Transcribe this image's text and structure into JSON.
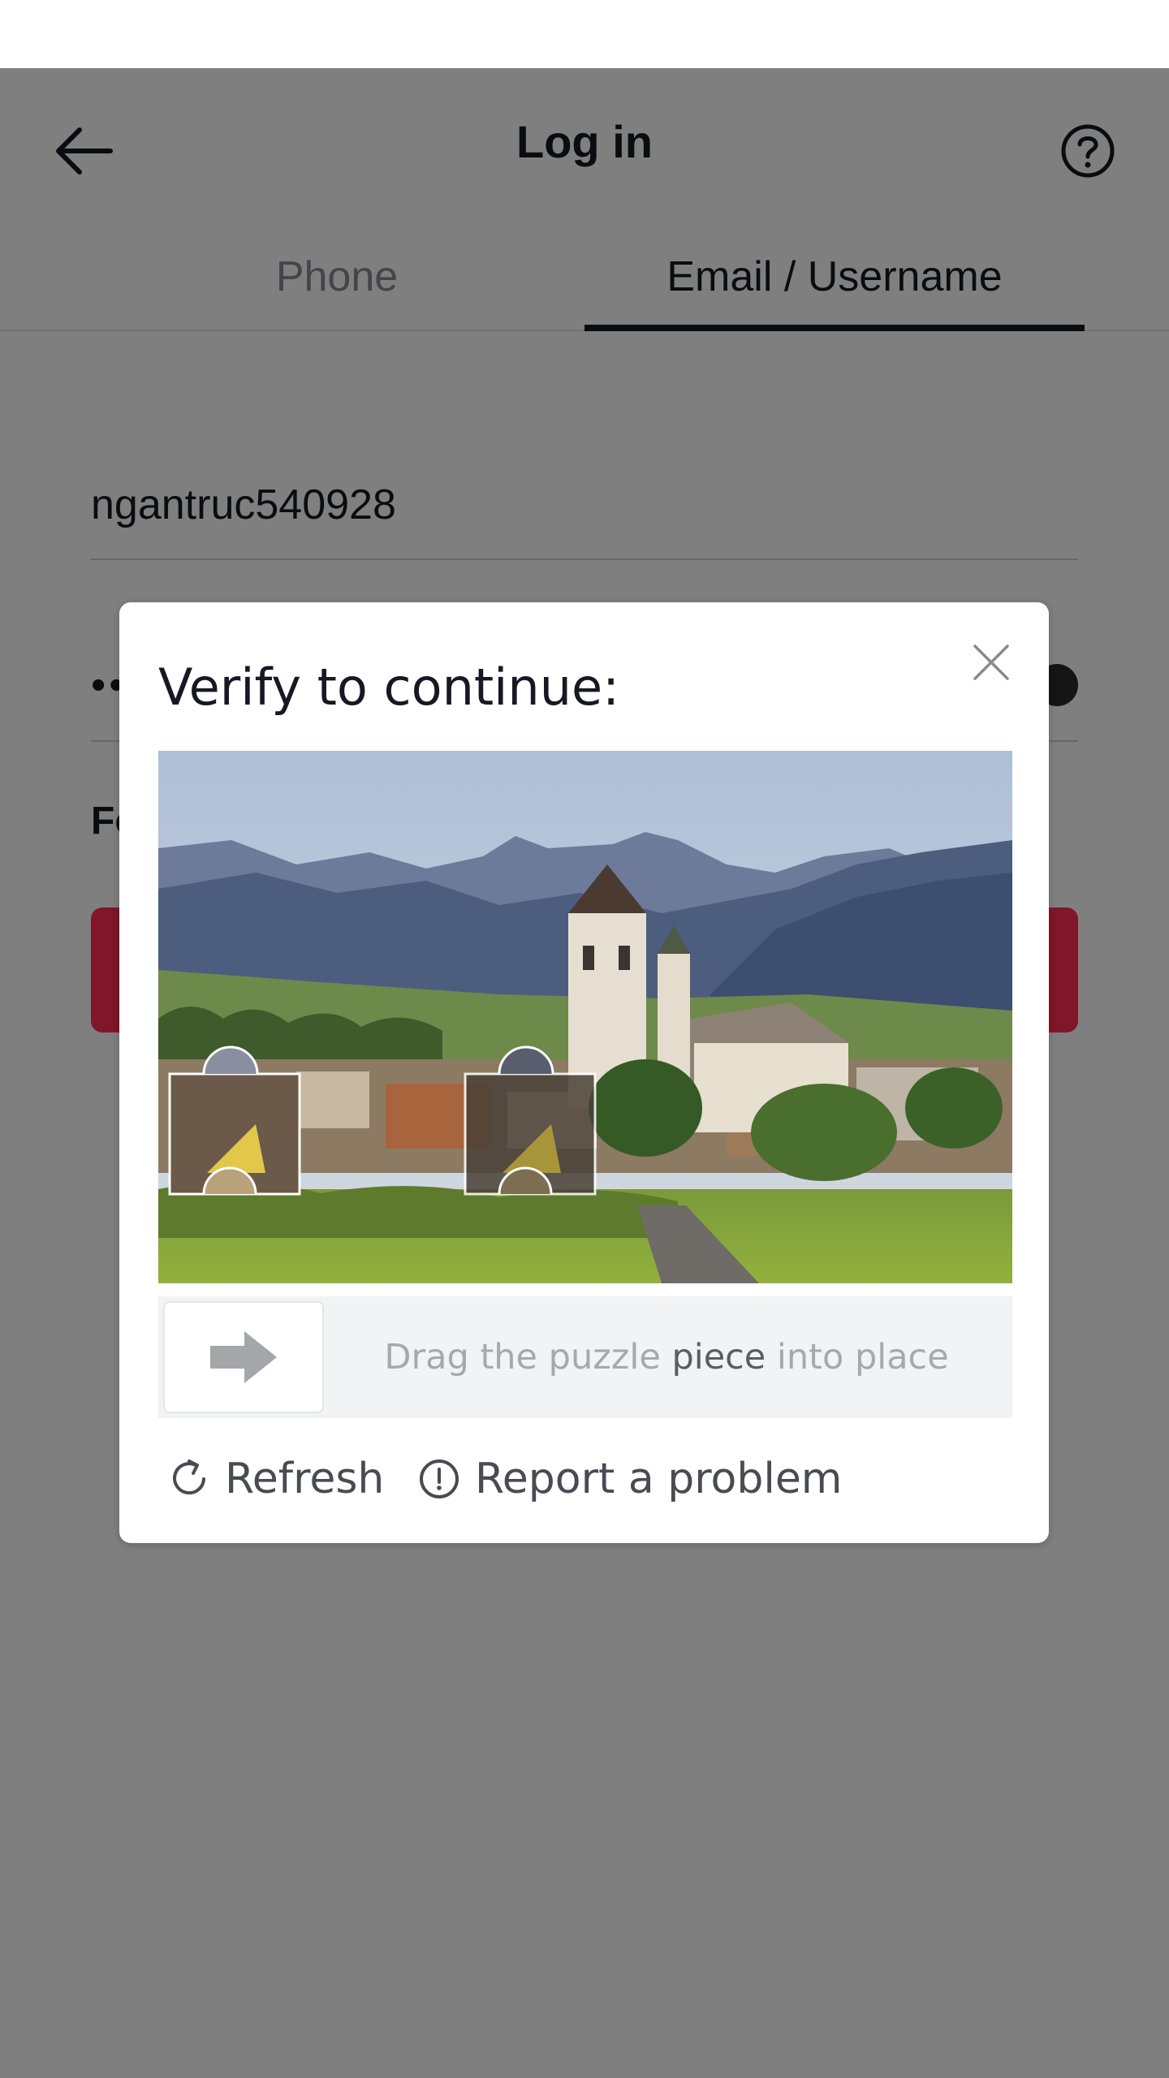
{
  "header": {
    "title": "Log in",
    "back_icon": "arrow-left-icon",
    "help_icon": "question-circle-icon"
  },
  "tabs": [
    {
      "label": "Phone",
      "active": false
    },
    {
      "label": "Email / Username",
      "active": true
    }
  ],
  "form": {
    "username_value": "ngantruc540928",
    "password_visible_fragment": "••",
    "forgot_fragment": "Fo",
    "login_button_color": "#fe2c55"
  },
  "captcha": {
    "title": "Verify to continue:",
    "close_icon": "close-icon",
    "slider": {
      "handle_icon": "arrow-right-icon",
      "hint_prefix": "Drag the puzzle ",
      "hint_mid": "piece",
      "hint_suffix": " into place"
    },
    "actions": {
      "refresh_label": "Refresh",
      "refresh_icon": "refresh-icon",
      "report_label": "Report a problem",
      "report_icon": "alert-circle-icon"
    }
  },
  "colors": {
    "accent": "#fe2c55",
    "text_primary": "#161823",
    "text_secondary": "#8a8b91",
    "overlay": "rgba(0,0,0,0.5)"
  }
}
